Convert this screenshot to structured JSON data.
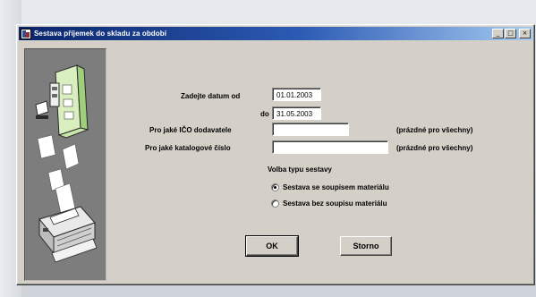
{
  "window": {
    "title": "Sestava příjemek do skladu za období",
    "minimize_glyph": "_",
    "maximize_glyph": "□",
    "close_glyph": "×"
  },
  "form": {
    "date_from": {
      "label": "Zadejte datum od",
      "value": "01.01.2003"
    },
    "date_to": {
      "label": "do",
      "value": "31.05.2003"
    },
    "supplier_ico": {
      "label": "Pro jaké IČO dodavatele",
      "value": "",
      "hint": "(prázdné pro všechny)"
    },
    "catalog_number": {
      "label": "Pro jaké katalogové číslo",
      "value": "",
      "hint": "(prázdné pro všechny)"
    },
    "report_type": {
      "label": "Volba typu sestavy",
      "options": [
        {
          "label": "Sestava se soupisem materiálu",
          "selected": true
        },
        {
          "label": "Sestava bez soupisu materiálu",
          "selected": false
        }
      ]
    }
  },
  "buttons": {
    "ok": "OK",
    "cancel": "Storno"
  },
  "illustration": {
    "icon": "printer-documents-illustration"
  }
}
